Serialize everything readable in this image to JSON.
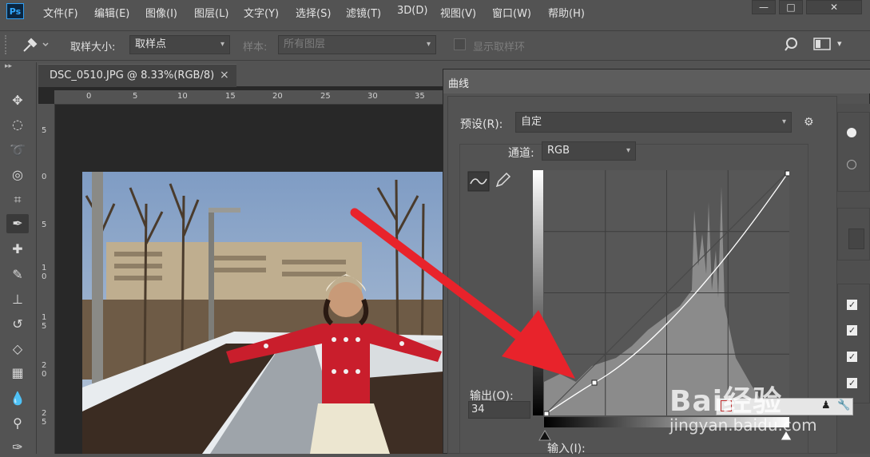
{
  "app": {
    "logo_text": "Ps"
  },
  "menu": [
    "文件(F)",
    "编辑(E)",
    "图像(I)",
    "图层(L)",
    "文字(Y)",
    "选择(S)",
    "滤镜(T)",
    "3D(D)",
    "视图(V)",
    "窗口(W)",
    "帮助(H)"
  ],
  "window_buttons": {
    "minimize": "—",
    "restore": "□",
    "close": "✕"
  },
  "options_bar": {
    "sample_size_label": "取样大小:",
    "sample_size_value": "取样点",
    "sample_label": "样本:",
    "sample_value": "所有图层",
    "show_ring_label": "显示取样环"
  },
  "document": {
    "tab_title": "DSC_0510.JPG @ 8.33%(RGB/8)",
    "tab_close": "×",
    "ruler_top": [
      "0",
      "5",
      "10",
      "15",
      "20",
      "25",
      "30",
      "35"
    ],
    "ruler_left": [
      "5",
      "0",
      "5",
      "1\n0",
      "1\n5",
      "2\n0",
      "2\n5"
    ]
  },
  "curves": {
    "title": "曲线",
    "preset_label": "预设(R):",
    "preset_value": "自定",
    "channel_label": "通道:",
    "channel_value": "RGB",
    "output_label": "输出(O):",
    "output_value": "34",
    "input_label": "输入(I):"
  },
  "watermark": {
    "text": "Bai经验",
    "url": "jingyan.baidu.com"
  },
  "colors": {
    "ui_bg": "#535353",
    "canvas": "#282828",
    "arrow": "#e8232b",
    "accent_blue": "#31a8ff"
  }
}
